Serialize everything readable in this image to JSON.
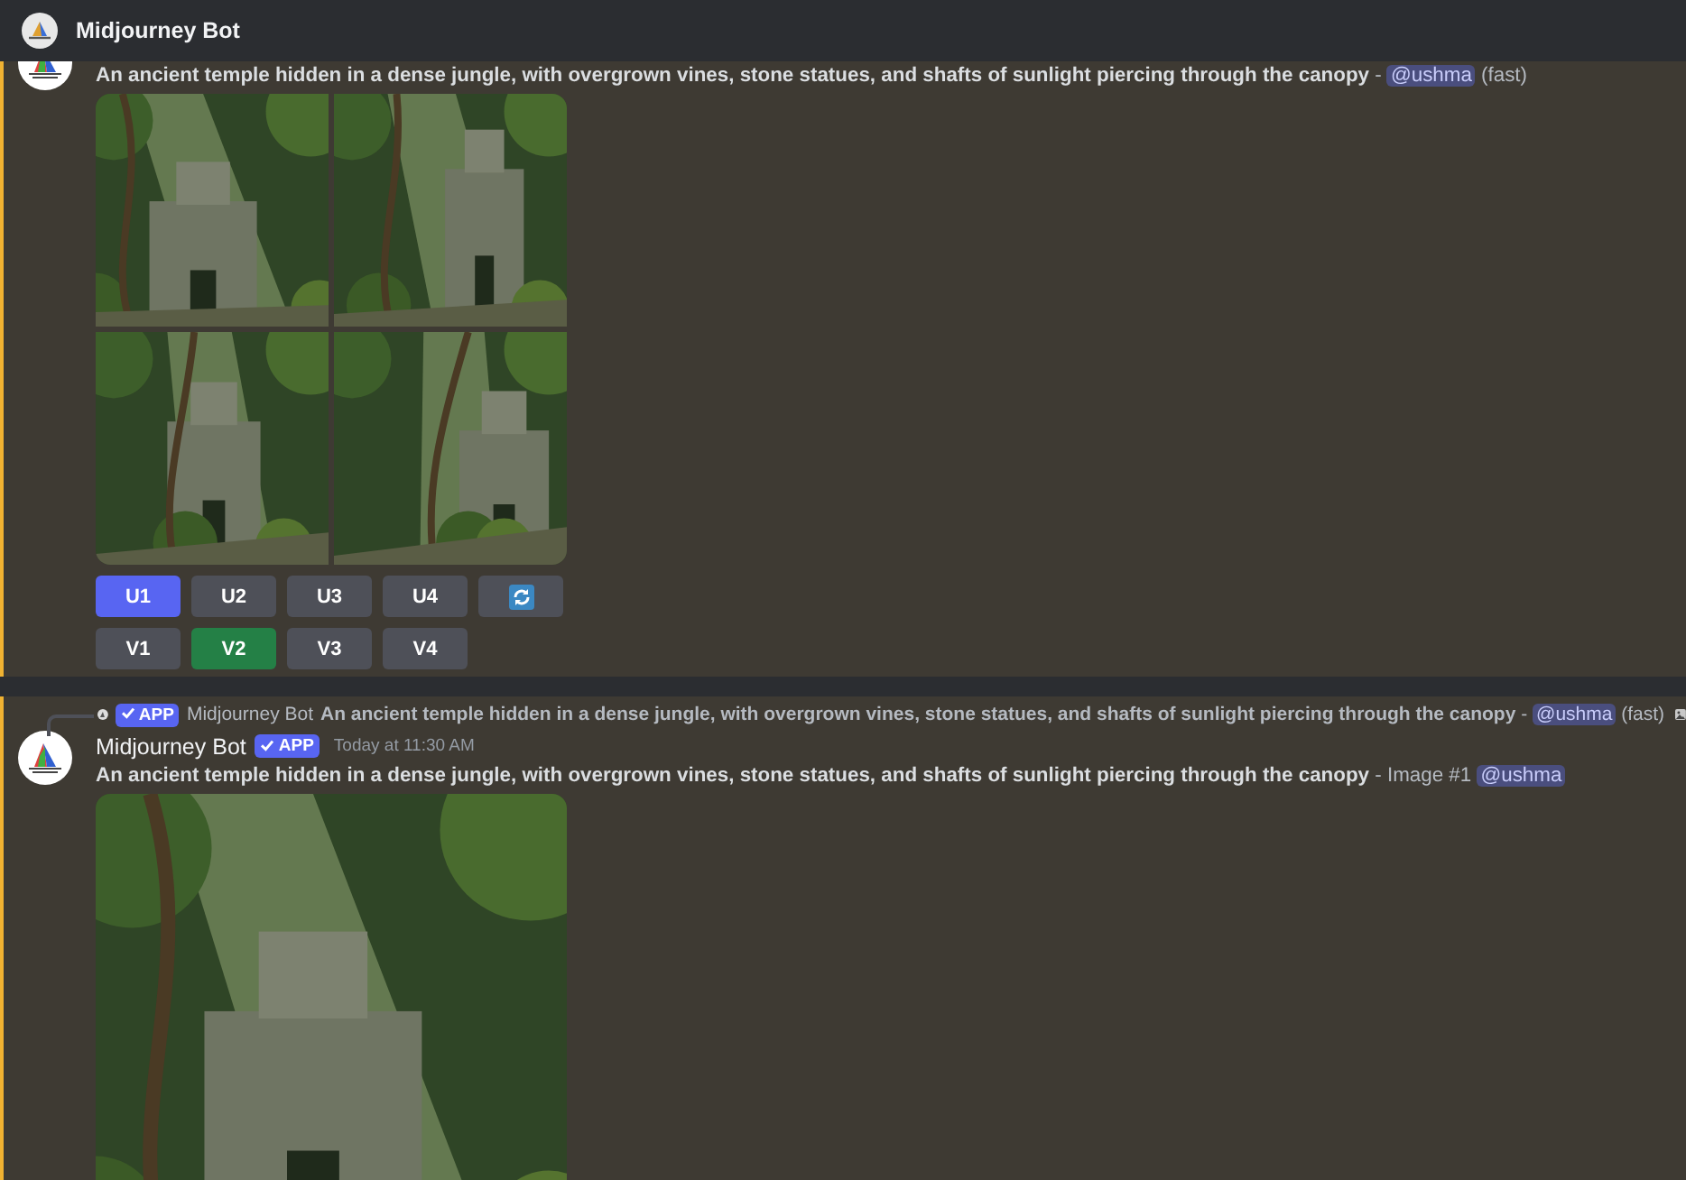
{
  "header": {
    "title": "Midjourney Bot"
  },
  "messages": [
    {
      "mentioned": true,
      "continued": true,
      "prompt": "An ancient temple hidden in a dense jungle, with overgrown vines, stone statues, and shafts of sunlight piercing through the canopy",
      "separator": "-",
      "mention": "@ushma",
      "suffix": "(fast)",
      "buttons": [
        {
          "kind": "upscale",
          "label": "U1",
          "selected": true
        },
        {
          "kind": "upscale",
          "label": "U2",
          "selected": false
        },
        {
          "kind": "upscale",
          "label": "U3",
          "selected": false
        },
        {
          "kind": "upscale",
          "label": "U4",
          "selected": false
        },
        {
          "kind": "reroll",
          "selected": false
        },
        {
          "kind": "variation",
          "label": "V1",
          "selected": false
        },
        {
          "kind": "variation",
          "label": "V2",
          "selected": true
        },
        {
          "kind": "variation",
          "label": "V3",
          "selected": false
        },
        {
          "kind": "variation",
          "label": "V4",
          "selected": false
        }
      ]
    },
    {
      "mentioned": true,
      "continued": false,
      "reply": {
        "badge": "APP",
        "author": "Midjourney Bot",
        "prompt": "An ancient temple hidden in a dense jungle, with overgrown vines, stone statues, and shafts of sunlight piercing through the canopy",
        "separator": "-",
        "mention": "@ushma",
        "suffix": "(fast)"
      },
      "author": "Midjourney Bot",
      "badge": "APP",
      "time": "Today at 11:30 AM",
      "prompt": "An ancient temple hidden in a dense jungle, with overgrown vines, stone statues, and shafts of sunlight piercing through the canopy",
      "separator": "-",
      "note": "Image #1",
      "mention": "@ushma"
    }
  ]
}
